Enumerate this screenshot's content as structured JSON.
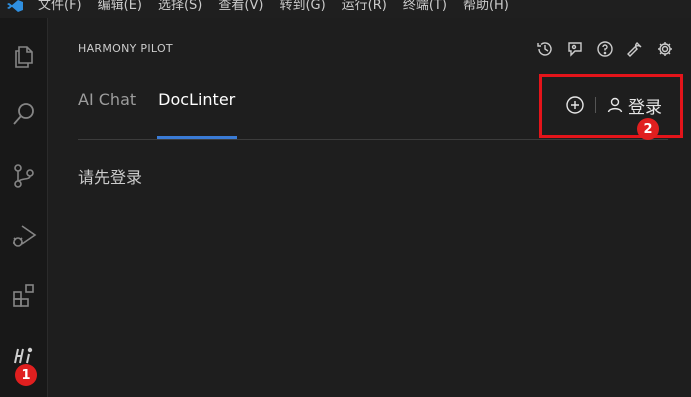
{
  "menubar": {
    "items": [
      "文件(F)",
      "编辑(E)",
      "选择(S)",
      "查看(V)",
      "转到(G)",
      "运行(R)",
      "终端(T)",
      "帮助(H)"
    ]
  },
  "activity": {
    "icons": [
      "explorer-icon",
      "search-icon",
      "source-control-icon",
      "run-debug-icon",
      "extensions-icon",
      "harmony-pilot-icon"
    ],
    "badge_1": "1"
  },
  "panel": {
    "title": "HARMONY PILOT",
    "title_actions": [
      "history-icon",
      "feedback-icon",
      "help-icon",
      "wrench-icon",
      "settings-icon"
    ],
    "tabs": [
      {
        "label": "AI Chat",
        "active": false
      },
      {
        "label": "DocLinter",
        "active": true
      }
    ],
    "login_label": "登录",
    "badge_2": "2",
    "message": "请先登录"
  },
  "colors": {
    "accent": "#3a7bd5",
    "highlight": "#e4141a",
    "badge": "#e01f1f"
  }
}
